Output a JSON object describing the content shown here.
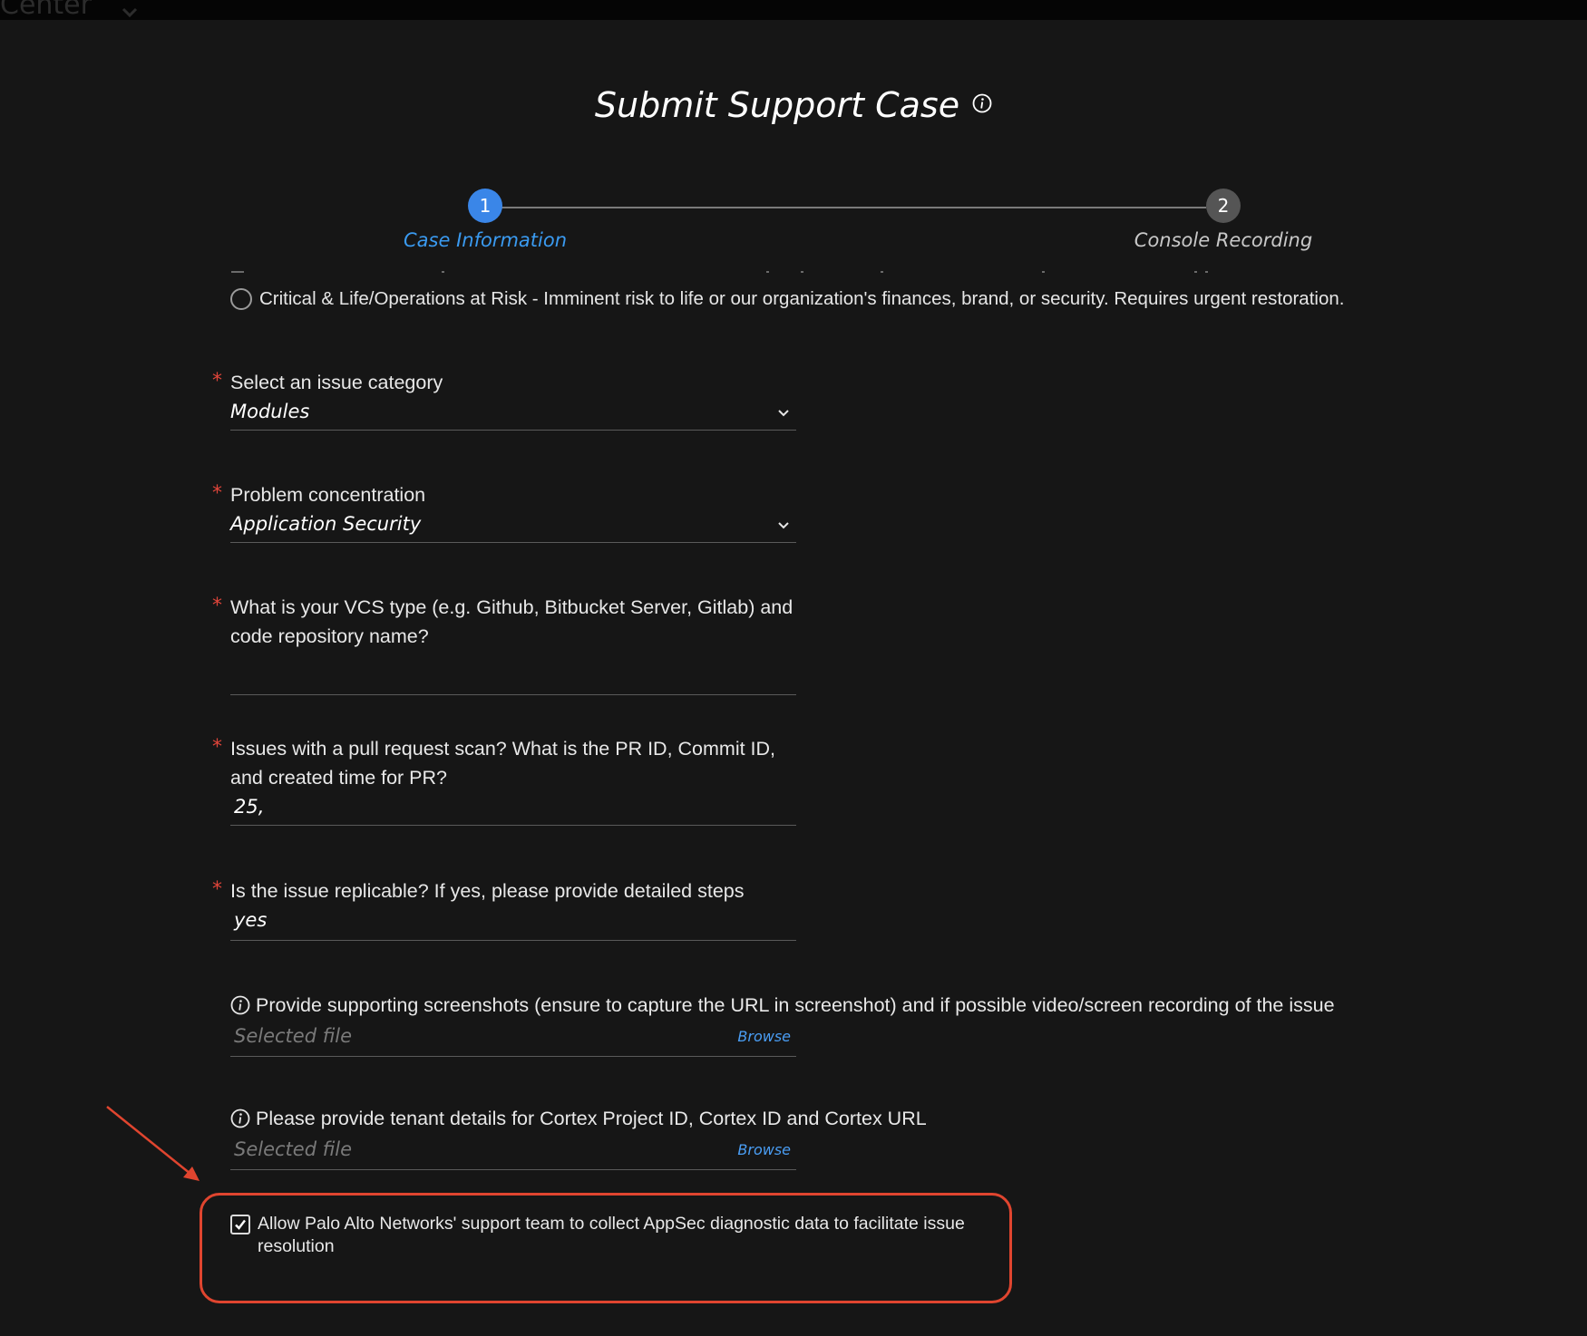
{
  "topbar": {
    "label": "Center"
  },
  "header": {
    "title": "Submit Support Case"
  },
  "stepper": {
    "steps": [
      {
        "number": "1",
        "label": "Case Information",
        "active": true
      },
      {
        "number": "2",
        "label": "Console Recording",
        "active": false
      }
    ]
  },
  "severity": {
    "option_label": "Critical & Life/Operations at Risk - Imminent risk to life or our organization's finances, brand, or security. Requires urgent restoration."
  },
  "fields": {
    "issue_category": {
      "label": "Select an issue category",
      "value": "Modules"
    },
    "problem_concentration": {
      "label": "Problem concentration",
      "value": "Application Security"
    },
    "vcs_type": {
      "label": "What is your VCS type (e.g. Github, Bitbucket Server, Gitlab) and code repository name?",
      "value": ""
    },
    "pr_scan": {
      "label": "Issues with a pull request scan? What is the PR ID, Commit ID, and created time for PR?",
      "value": "25,"
    },
    "replicable": {
      "label": "Is the issue replicable? If yes, please provide detailed steps",
      "value": "yes"
    },
    "required_marker": "*"
  },
  "uploads": {
    "screenshots": {
      "label": "Provide supporting screenshots (ensure to capture the URL in screenshot) and if possible video/screen recording of the issue",
      "placeholder": "Selected file",
      "browse_label": "Browse"
    },
    "tenant": {
      "label": "Please provide tenant details for Cortex Project ID, Cortex ID and Cortex URL",
      "placeholder": "Selected file",
      "browse_label": "Browse"
    }
  },
  "consent": {
    "checked": true,
    "label": "Allow Palo Alto Networks' support team to collect AppSec diagnostic data to facilitate issue resolution"
  },
  "colors": {
    "background": "#161616",
    "accent": "#3a86e8",
    "link": "#4a9ef5",
    "required": "#e0453a",
    "annotation": "#e0452f"
  }
}
